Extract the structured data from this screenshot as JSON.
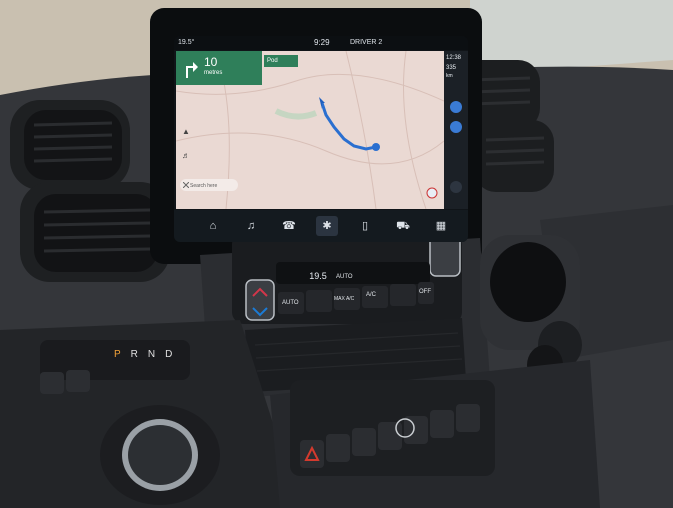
{
  "screen": {
    "status_bar": {
      "temperature": "19.5°",
      "time": "9:29",
      "profile": "DRIVER 2"
    },
    "map": {
      "turn_distance": "10",
      "turn_unit": "metres",
      "next_label": "Pod",
      "search_label": "Search here"
    },
    "right_panel": {
      "time": "12:38",
      "eta": "335",
      "eta_unit": "km"
    },
    "nav_items": [
      "home-icon",
      "music-icon",
      "phone-icon",
      "fan-icon",
      "phone-mirror-icon",
      "car-icon",
      "apps-icon"
    ]
  },
  "climate": {
    "temperature": "19.5",
    "mode_label": "AUTO",
    "labels": [
      "AUTO",
      "MAX A/C",
      "A/C",
      "OFF"
    ]
  },
  "gear_selector": {
    "letters": [
      "P",
      "R",
      "N",
      "D"
    ]
  },
  "colors": {
    "map_background": "#ead9d3",
    "route": "#2a6fd0",
    "turn_card": "#2f7f5a",
    "hazard_button": "#d33a2e",
    "climate_blue": "#1b7bd6"
  }
}
